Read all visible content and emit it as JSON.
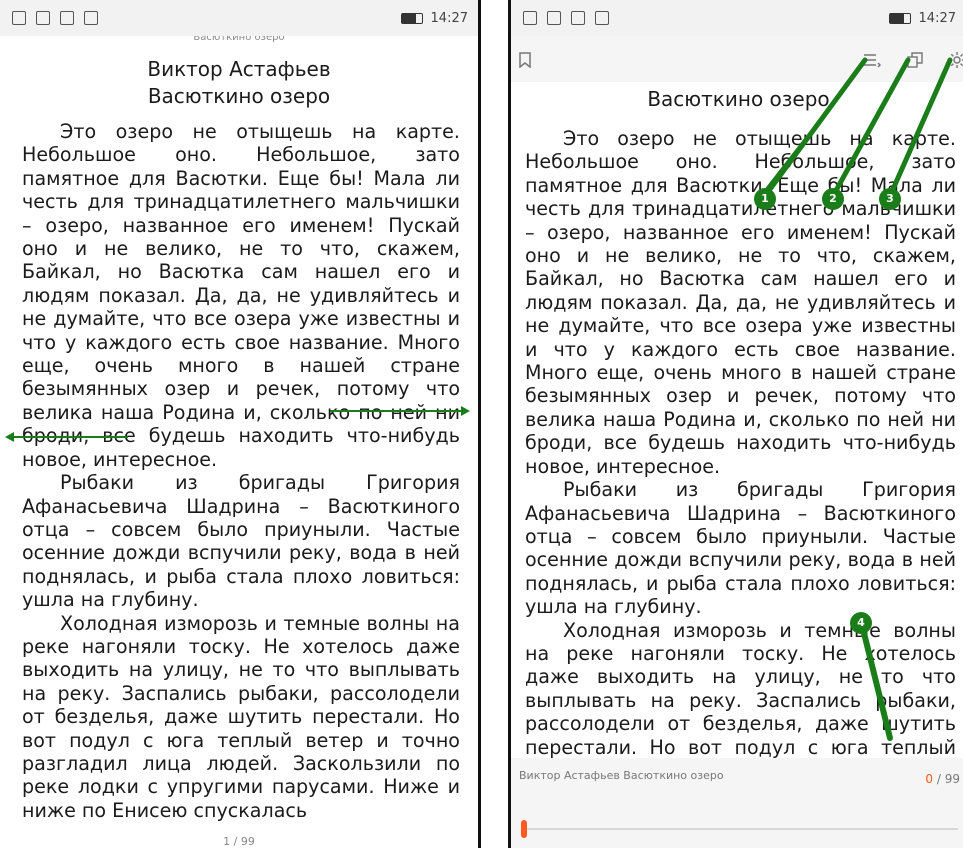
{
  "left": {
    "status_time": "14:27",
    "small_title": "Васюткино озеро",
    "author": "Виктор Астафьев",
    "title": "Васюткино озеро",
    "paragraphs": [
      "Это озеро не отыщешь на карте. Небольшое оно. Небольшое, зато памятное для Васютки. Еще бы! Мала ли честь для тринадцатилетнего мальчишки – озеро, названное его именем! Пускай оно и не велико, не то что, скажем, Байкал, но Васютка сам нашел его и людям показал. Да, да, не удивляйтесь и не думайте, что все озера уже известны и что у каждого есть свое название. Много еще, очень много в нашей стране безымянных озер и речек, потому что велика наша Родина и, сколько по ней ни броди, все будешь находить что-нибудь новое, интересное.",
      "Рыбаки из бригады Григория Афанасьевича Шадрина – Васюткиного отца – совсем было приуныли. Частые осенние дожди вспучили реку, вода в ней поднялась, и рыба стала плохо ловиться: ушла на глубину.",
      "Холодная изморозь и темные волны на реке нагоняли тоску. Не хотелось даже выходить на улицу, не то что выплывать на реку. Заспались рыбаки, рассолодели от безделья, даже шутить перестали. Но вот подул с юга теплый ветер и точно разгладил лица людей. Заскользили по реке лодки с упругими парусами. Ниже и ниже по Енисею спускалась"
    ],
    "page_indicator": "1 / 99"
  },
  "right": {
    "status_time": "14:27",
    "title": "Васюткино озеро",
    "paragraphs": [
      "Это озеро не отыщешь на карте. Небольшое оно. Небольшое, зато памятное для Васютки. Еще бы! Мала ли честь для тринадцатилетнего мальчишки – озеро, названное его именем! Пускай оно и не велико, не то что, скажем, Байкал, но Васютка сам нашел его и людям показал. Да, да, не удивляйтесь и не думайте, что все озера уже известны и что у каждого есть свое название. Много еще, очень много в нашей стране безымянных озер и речек, потому что велика наша Родина и, сколько по ней ни броди, все будешь находить что-нибудь новое, интересное.",
      "Рыбаки из бригады Григория Афанасьевича Шадрина – Васюткиного отца – совсем было приуныли. Частые осенние дожди вспучили реку, вода в ней поднялась, и рыба стала плохо ловиться: ушла на глубину.",
      "Холодная изморозь и темные волны на реке нагоняли тоску. Не хотелось даже выходить на улицу, не то что выплывать на реку. Заспались рыбаки, рассолодели от безделья, даже шутить перестали. Но вот подул с юга теплый ветер"
    ],
    "footer_author": "Виктор Астафьев Васюткино озеро",
    "page_current": "0",
    "page_total": "/ 99",
    "progress_fraction": 0,
    "markers": [
      "1",
      "2",
      "3",
      "4"
    ],
    "icons": [
      "bookmark-icon",
      "contents-icon",
      "copy-pages-icon",
      "settings-gear-icon"
    ]
  },
  "colors": {
    "accent": "#ff5a1f",
    "annotation": "#1a7d1a"
  }
}
